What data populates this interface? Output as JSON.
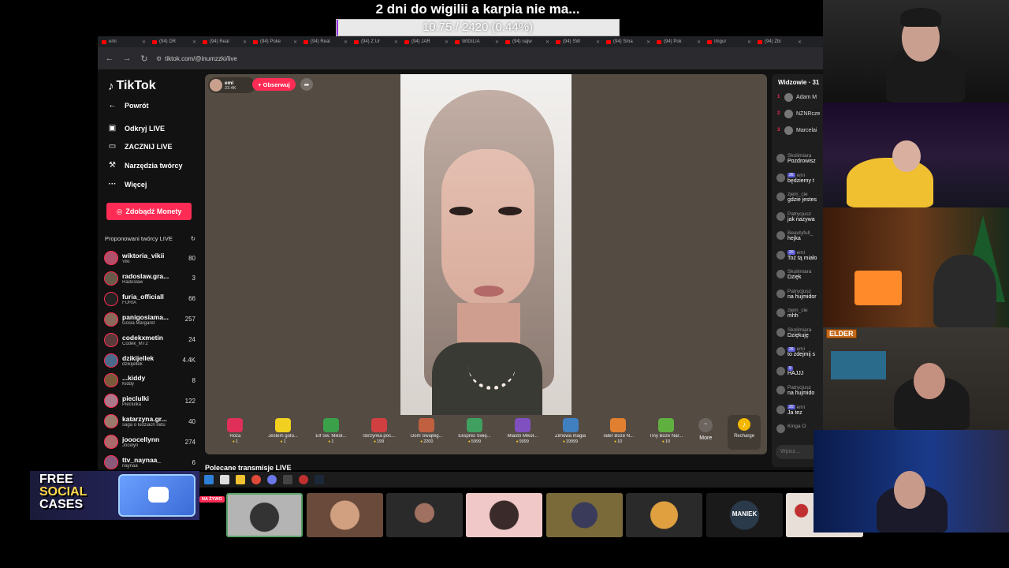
{
  "overlay": {
    "goal_title": "2 dni do wigilii a karpia nie ma...",
    "goal_progress_text": "10.75 / 2420 (0.44%)",
    "goal_progress": 0.0044
  },
  "browser": {
    "tabs": [
      "emi",
      "(94) DR",
      "(94) Real",
      "(94) Poke",
      "(94) Real",
      "(94) Z Ur",
      "(94) JAR",
      "WIGILIA",
      "(94) najw",
      "(94) SW",
      "(94) Sma",
      "(94) Pok",
      "Imgur",
      "(94) Zbi"
    ],
    "url": "tiktok.com/@inumzzki/live"
  },
  "sidebar": {
    "logo": "TikTok",
    "items": [
      {
        "label": "Powrót",
        "icon": "back-arrow-icon"
      },
      {
        "label": "Odkryj LIVE",
        "icon": "live-tv-icon"
      },
      {
        "label": "ZACZNIJ LIVE",
        "icon": "camera-icon"
      },
      {
        "label": "Narzędzia twórcy",
        "icon": "tools-icon"
      },
      {
        "label": "Więcej",
        "icon": "more-dots-icon"
      }
    ],
    "coins_button": "Zdobądź Monety",
    "suggested_header": "Proponowani twórcy LIVE",
    "creators": [
      {
        "name": "wiktoria_vikii",
        "sub": "Viki",
        "count": "80",
        "color": "#b0506a"
      },
      {
        "name": "radoslaw.gra...",
        "sub": "Radosław",
        "count": "3",
        "color": "#6a5a4a"
      },
      {
        "name": "furia_officiall",
        "sub": "FURIA",
        "count": "66",
        "color": "#222222"
      },
      {
        "name": "panigosiama...",
        "sub": "Gosia Margaret",
        "count": "257",
        "color": "#8a6a5a"
      },
      {
        "name": "codekxmetin",
        "sub": "Codek_MT2",
        "count": "24",
        "color": "#5a3a3a"
      },
      {
        "name": "dzikijellek",
        "sub": "dzikijellek",
        "count": "4.4K",
        "color": "#4a6a8a"
      },
      {
        "name": "...kiddy",
        "sub": "Kiddy",
        "count": "8",
        "color": "#7a5a3a"
      },
      {
        "name": "pieclulki",
        "sub": "Pieclulka",
        "count": "122",
        "color": "#aa7a8a"
      },
      {
        "name": "katarzyna.gr...",
        "sub": "saga o ludziach lodu",
        "count": "40",
        "color": "#9a7a6a"
      },
      {
        "name": "jooocellynn",
        "sub": "Jocelyn",
        "count": "274",
        "color": "#aa6a6a"
      },
      {
        "name": "ttv_naynaa_",
        "sub": "naynaa",
        "count": "6",
        "color": "#8a5a7a"
      }
    ]
  },
  "live": {
    "host_name": "emi",
    "host_likes": "23.4K",
    "follow_label": "+ Obserwuj",
    "gifts": [
      {
        "name": "Róża",
        "price": "1",
        "color": "#e0305a"
      },
      {
        "name": "Jestem goto...",
        "price": "1",
        "color": "#f2d020"
      },
      {
        "name": "Elf Św. Mikoł...",
        "price": "1",
        "color": "#3aa04a"
      },
      {
        "name": "Skrzynka poc...",
        "price": "199",
        "color": "#d04040"
      },
      {
        "name": "Dom Świąteg...",
        "price": "2200",
        "color": "#c06040"
      },
      {
        "name": "Ekspres Świę...",
        "price": "5999",
        "color": "#40a060"
      },
      {
        "name": "Miasto Mikoł...",
        "price": "9999",
        "color": "#8050c0"
      },
      {
        "name": "Zimowa magia",
        "price": "19999",
        "color": "#4080c0"
      },
      {
        "name": "Tater Boże N...",
        "price": "10",
        "color": "#e08030"
      },
      {
        "name": "Tiny Boże Nar...",
        "price": "10",
        "color": "#60b040"
      }
    ],
    "more_label": "More",
    "recharge_label": "Recharge",
    "recommended_label": "Polecane transmisje LIVE"
  },
  "chat": {
    "title": "Widzowie · 31",
    "viewers": [
      {
        "rank": "1",
        "name": "Adam M"
      },
      {
        "rank": "2",
        "name": "NZNRcze"
      },
      {
        "rank": "3",
        "name": "Marcelai"
      }
    ],
    "messages": [
      {
        "user": "Skolimiara",
        "level": "",
        "text": "Pozdrowisz"
      },
      {
        "user": "emi",
        "level": "26",
        "text": "będziemy t"
      },
      {
        "user": "zjem_cie",
        "level": "",
        "text": "gdzie jestes"
      },
      {
        "user": "Patrycjusz",
        "level": "",
        "text": "jak nazywa"
      },
      {
        "user": "Beautyfull_",
        "level": "",
        "text": "hejka"
      },
      {
        "user": "emi",
        "level": "20",
        "text": "Toż tą miało"
      },
      {
        "user": "Skolimiara",
        "level": "",
        "text": "Dzięk"
      },
      {
        "user": "Patrycjusz",
        "level": "",
        "text": "na hujmidor"
      },
      {
        "user": "zjem_cie",
        "level": "",
        "text": "mhh"
      },
      {
        "user": "Skolimiara",
        "level": "",
        "text": "Dziękuję"
      },
      {
        "user": "emi",
        "level": "26",
        "text": "to zdejmij s"
      },
      {
        "user": "",
        "level": "9",
        "text": "HAJJJ"
      },
      {
        "user": "Patrycjusz",
        "level": "",
        "text": "na hujmido"
      },
      {
        "user": "emi",
        "level": "20",
        "text": "Ja tez"
      },
      {
        "user": "Kinga O",
        "level": "",
        "text": ""
      }
    ],
    "input_placeholder": "Wpisz..."
  },
  "ad": {
    "line1": "FREE",
    "line2": "SOCIAL",
    "line3": "CASES"
  },
  "cams": {
    "elder_label": "ELDER"
  },
  "live_badge": "NA ŻYWO",
  "thumb_labels": [
    "MANIEK"
  ]
}
